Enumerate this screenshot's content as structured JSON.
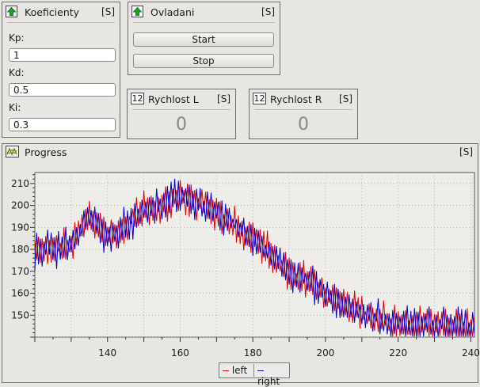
{
  "koeficienty": {
    "title": "Koeficienty",
    "s": "[S]",
    "kp_label": "Kp:",
    "kp_value": "1",
    "kd_label": "Kd:",
    "kd_value": "0.5",
    "ki_label": "Ki:",
    "ki_value": "0.3",
    "icon": "arrow-up-icon"
  },
  "ovladani": {
    "title": "Ovladani",
    "s": "[S]",
    "start_label": "Start",
    "stop_label": "Stop",
    "icon": "arrow-up-icon"
  },
  "rychlost_l": {
    "title": "Rychlost L",
    "s": "[S]",
    "value": "0",
    "icon_text": "12"
  },
  "rychlost_r": {
    "title": "Rychlost R",
    "s": "[S]",
    "value": "0",
    "icon_text": "12"
  },
  "progress": {
    "title": "Progress",
    "s": "[S]",
    "icon": "waveform-icon"
  },
  "chart_data": {
    "type": "line",
    "title": "",
    "xlabel": "",
    "ylabel": "",
    "xlim": [
      120,
      241
    ],
    "ylim": [
      140,
      215
    ],
    "x_ticks": [
      140,
      160,
      180,
      200,
      220,
      240
    ],
    "y_ticks": [
      150,
      160,
      170,
      180,
      190,
      200,
      210
    ],
    "grid": true,
    "legend": "bottom-center",
    "series": [
      {
        "name": "left",
        "color": "#e00000"
      },
      {
        "name": "right",
        "color": "#0000cc"
      }
    ],
    "trend_x": [
      120,
      130,
      135,
      140,
      145,
      150,
      155,
      160,
      165,
      170,
      175,
      180,
      185,
      190,
      195,
      200,
      205,
      210,
      215,
      220,
      230,
      241
    ],
    "trend_y": [
      179,
      182,
      196,
      186,
      191,
      198,
      200,
      204,
      201,
      197,
      191,
      185,
      178,
      169,
      165,
      160,
      155,
      151,
      148,
      146,
      145,
      145
    ]
  }
}
